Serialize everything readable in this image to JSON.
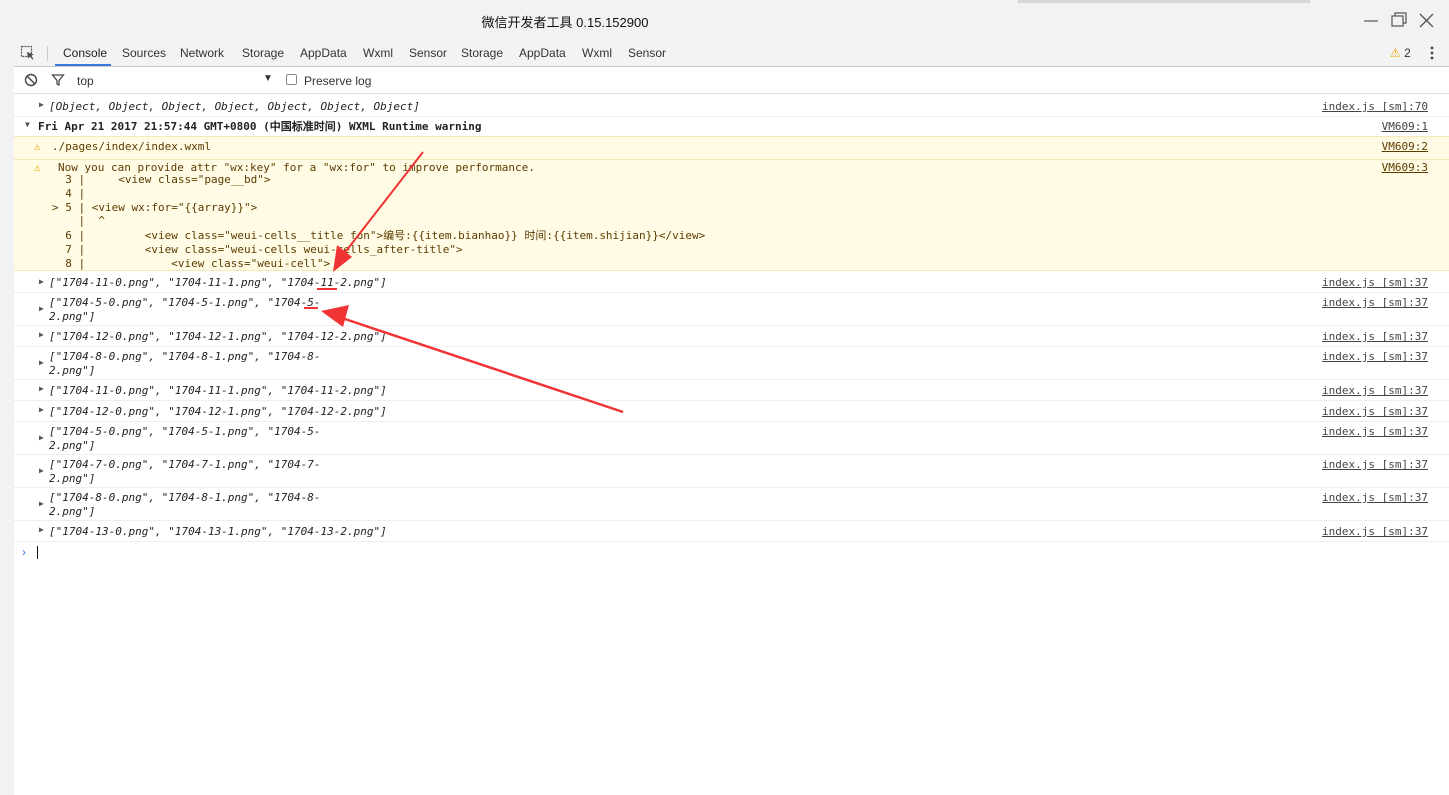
{
  "window": {
    "title": "微信开发者工具 0.15.152900"
  },
  "tabs": [
    "Console",
    "Sources",
    "Network",
    "Storage",
    "AppData",
    "Wxml",
    "Sensor",
    "Storage",
    "AppData",
    "Wxml",
    "Sensor"
  ],
  "warnings_count": "2",
  "filter": {
    "context": "top",
    "preserve_log": "Preserve log"
  },
  "console": {
    "first": {
      "msg": "[Object, Object, Object, Object, Object, Object, Object]",
      "src": "index.js [sm]:70"
    },
    "group": {
      "msg": "Fri Apr 21 2017 21:57:44 GMT+0800 (中国标准时间) WXML Runtime warning",
      "src": "VM609:1"
    },
    "warn1": {
      "msg": "./pages/index/index.wxml",
      "src": "VM609:2"
    },
    "warn2": {
      "msg": "Now you can provide attr \"wx:key\" for a \"wx:for\" to improve performance.",
      "src": "VM609:3"
    },
    "code": [
      "  3 |     <view class=\"page__bd\">",
      "  4 |",
      "> 5 | <view wx:for=\"{{array}}\">",
      "    |  ^",
      "  6 |         <view class=\"weui-cells__title fon\">编号:{{item.bianhao}} 时间:{{item.shijian}}</view>",
      "  7 |         <view class=\"weui-cells weui-cells_after-title\">",
      "  8 |             <view class=\"weui-cell\">"
    ],
    "rows": [
      {
        "l1": "[\"1704-11-0.png\", \"1704-11-1.png\", \"1704-11-2.png\"]",
        "l2": "",
        "src": "index.js [sm]:37"
      },
      {
        "l1": "[\"1704-5-0.png\", \"1704-5-1.png\", \"1704-5-",
        "l2": "2.png\"]",
        "src": "index.js [sm]:37"
      },
      {
        "l1": "[\"1704-12-0.png\", \"1704-12-1.png\", \"1704-12-2.png\"]",
        "l2": "",
        "src": "index.js [sm]:37"
      },
      {
        "l1": "[\"1704-8-0.png\", \"1704-8-1.png\", \"1704-8-",
        "l2": "2.png\"]",
        "src": "index.js [sm]:37"
      },
      {
        "l1": "[\"1704-11-0.png\", \"1704-11-1.png\", \"1704-11-2.png\"]",
        "l2": "",
        "src": "index.js [sm]:37"
      },
      {
        "l1": "[\"1704-12-0.png\", \"1704-12-1.png\", \"1704-12-2.png\"]",
        "l2": "",
        "src": "index.js [sm]:37"
      },
      {
        "l1": "[\"1704-5-0.png\", \"1704-5-1.png\", \"1704-5-",
        "l2": "2.png\"]",
        "src": "index.js [sm]:37"
      },
      {
        "l1": "[\"1704-7-0.png\", \"1704-7-1.png\", \"1704-7-",
        "l2": "2.png\"]",
        "src": "index.js [sm]:37"
      },
      {
        "l1": "[\"1704-8-0.png\", \"1704-8-1.png\", \"1704-8-",
        "l2": "2.png\"]",
        "src": "index.js [sm]:37"
      },
      {
        "l1": "[\"1704-13-0.png\", \"1704-13-1.png\", \"1704-13-2.png\"]",
        "l2": "",
        "src": "index.js [sm]:37"
      }
    ],
    "prompt": "›"
  },
  "colors": {
    "annotation": "#f03434",
    "accent": "#3879d9",
    "warning": "#e9a800"
  }
}
